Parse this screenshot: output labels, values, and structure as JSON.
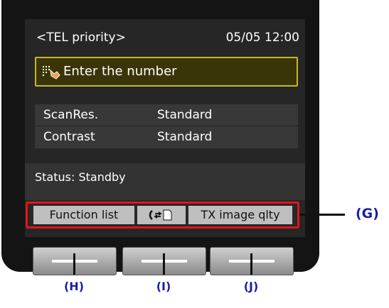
{
  "screen": {
    "mode": "<TEL priority>",
    "datetime": "05/05 12:00",
    "prompt": "Enter the number",
    "prompt_icon": "hand-pointer-icon",
    "settings": [
      {
        "key": "ScanRes.",
        "value": "Standard"
      },
      {
        "key": "Contrast",
        "value": "Standard"
      }
    ],
    "status": "Status: Standby"
  },
  "function_bar": [
    {
      "label": "Function list"
    },
    {
      "label": "",
      "icon": "hook-switch-icon"
    },
    {
      "label": "TX image qlty"
    }
  ],
  "callouts": {
    "function_bar": "(G)",
    "button_left": "(H)",
    "button_center": "(I)",
    "button_right": "(J)"
  },
  "colors": {
    "highlight": "#e0161b",
    "label": "#1b1fa0",
    "prompt_border": "#c8b81f"
  }
}
